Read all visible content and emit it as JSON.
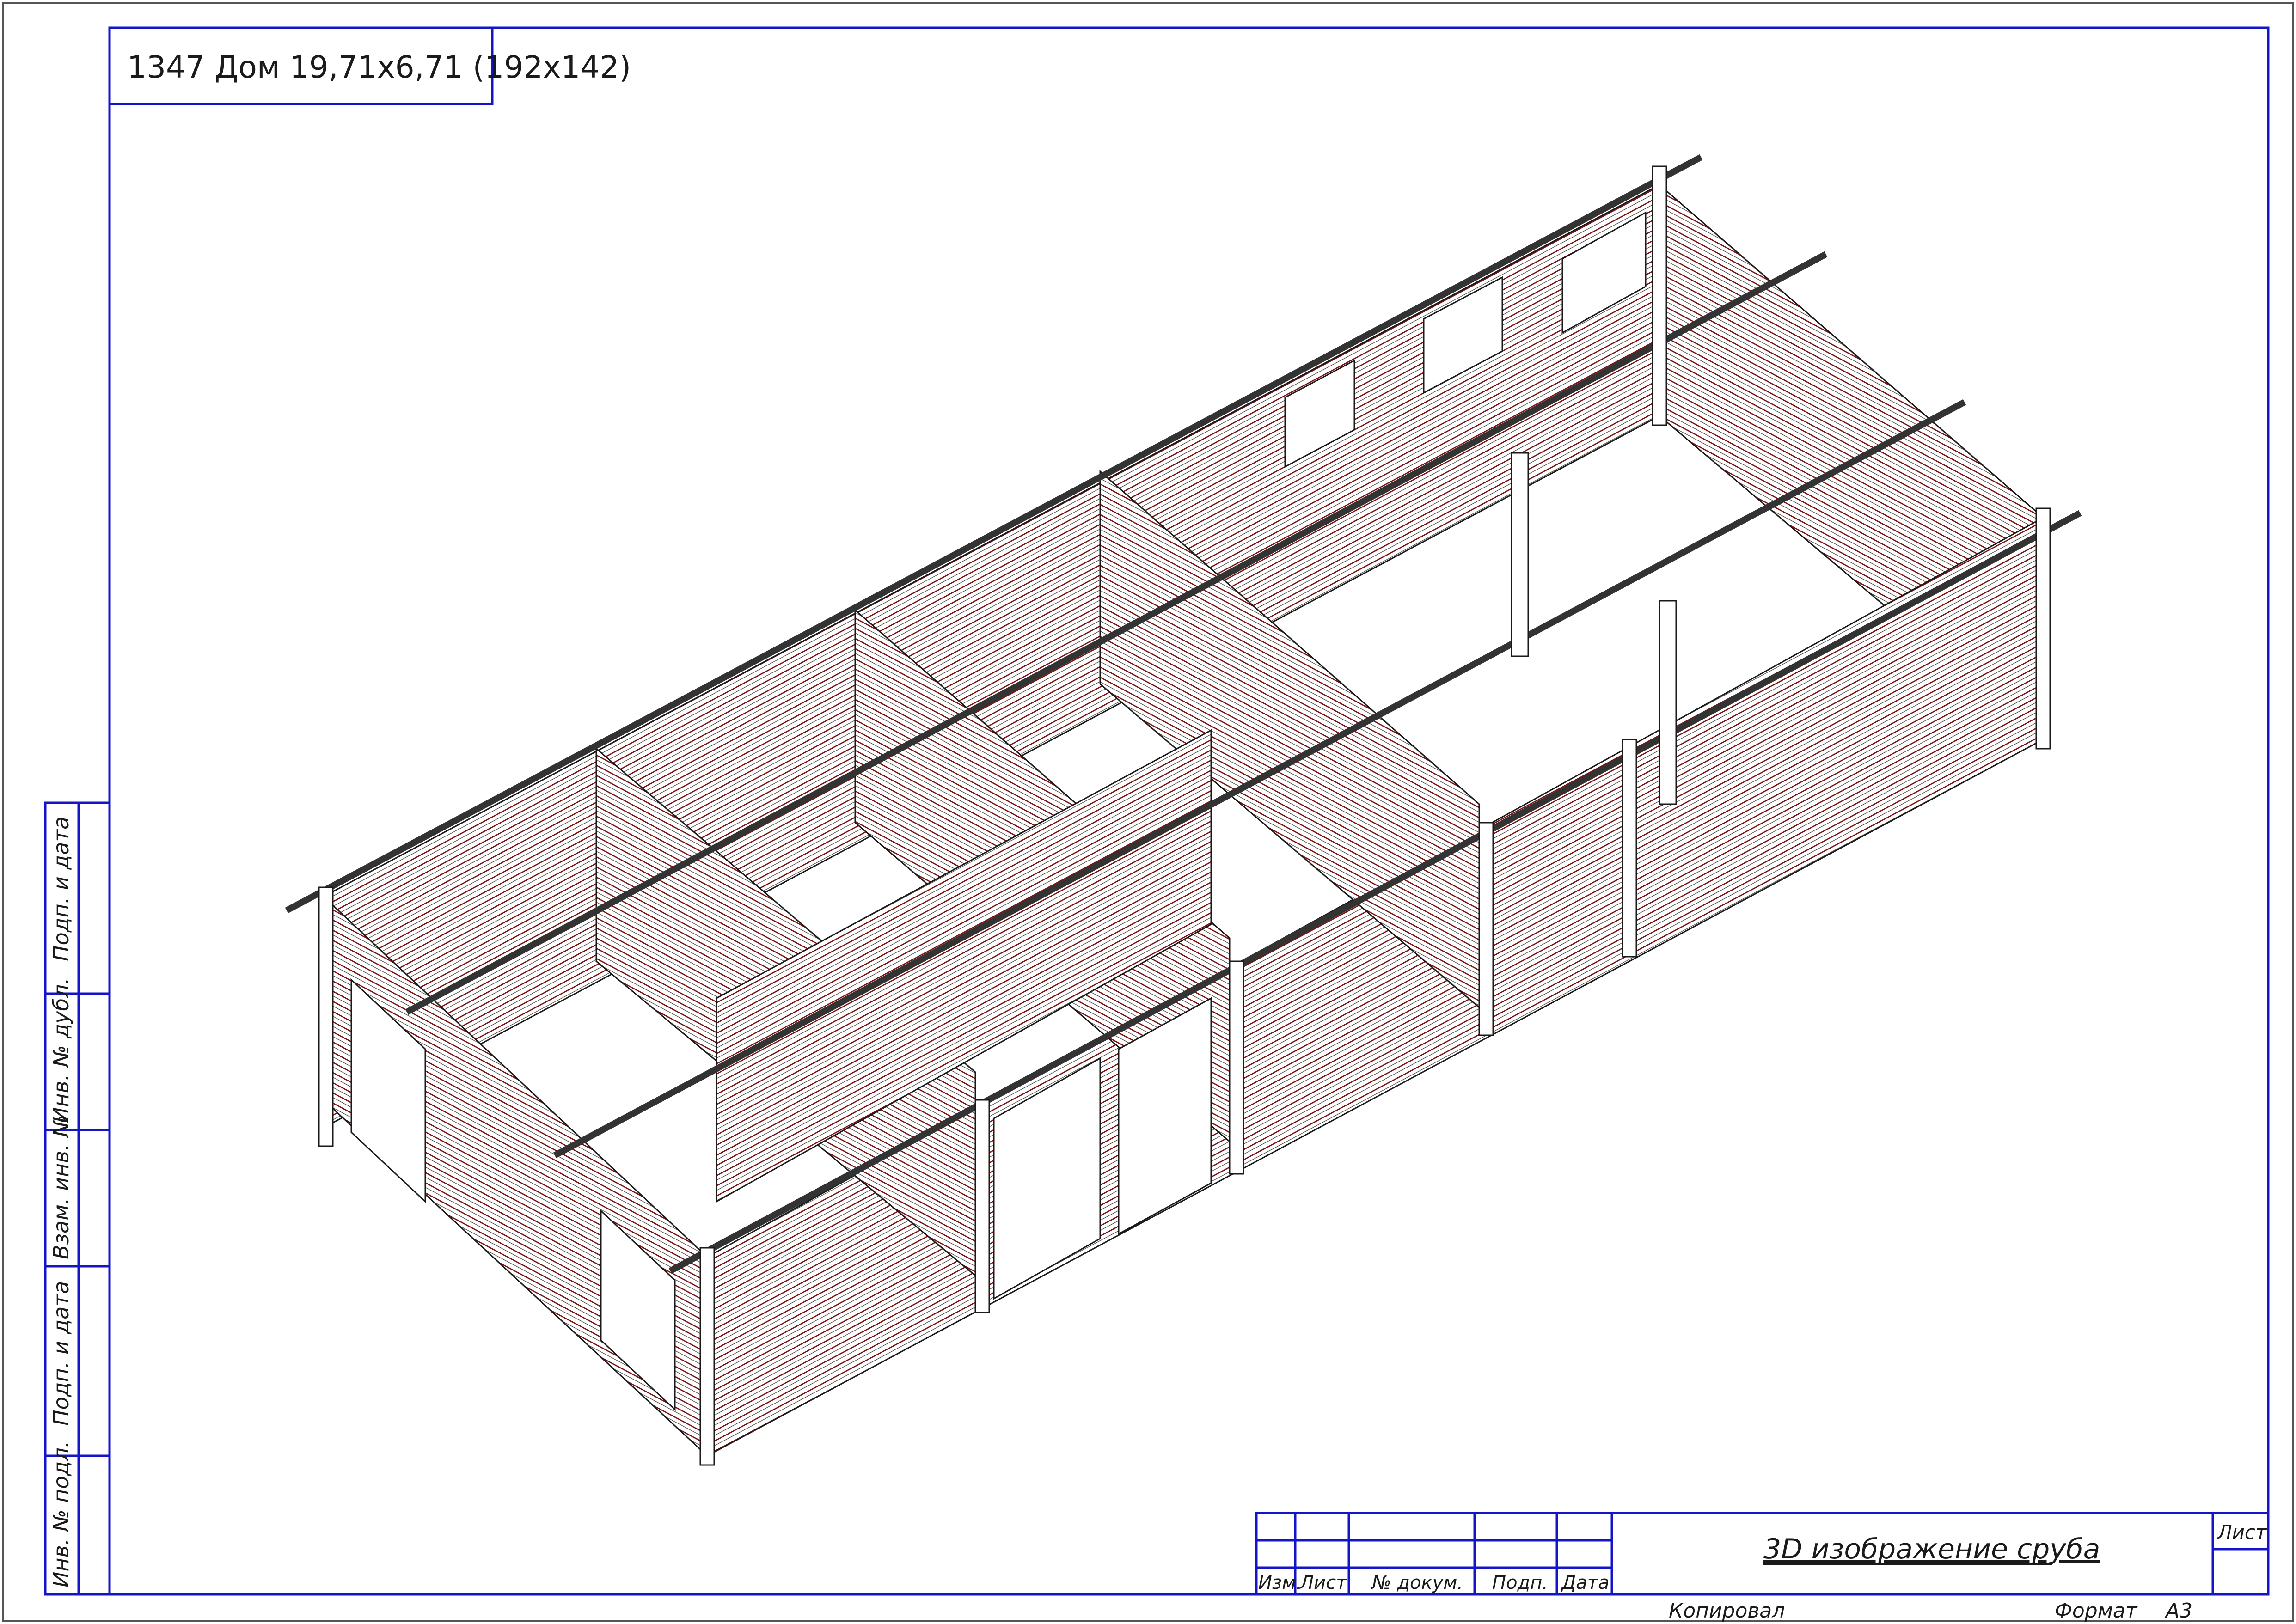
{
  "drawing": {
    "title": "1347 Дом 19,71х6,71 (192х142)",
    "sheet_caption": "3D изображение сруба",
    "sheet_label": "Лист",
    "copied_label": "Копировал",
    "format_label": "Формат",
    "format_value": "А3"
  },
  "stamp_columns": [
    "Изм.",
    "Лист",
    "№ докум.",
    "Подп.",
    "Дата"
  ],
  "side_stamp": [
    "Подп. и дата",
    "Инв. № дубл.",
    "Взам. инв. №",
    "Подп. и дата",
    "Инв. № подл."
  ],
  "colors": {
    "frame": "#1414c8",
    "log_line": "#7a1414",
    "outline": "#1a1a1a"
  }
}
